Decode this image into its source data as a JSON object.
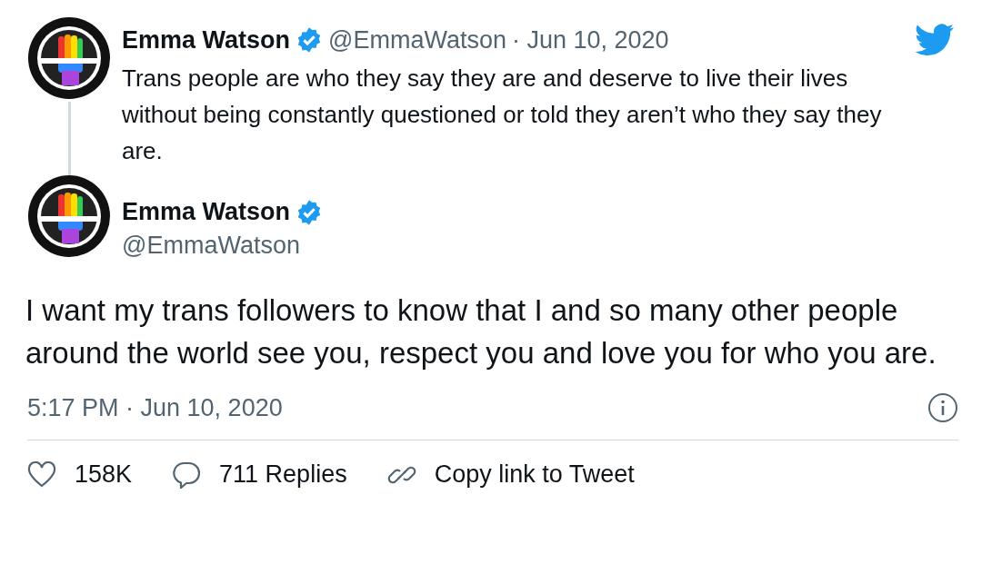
{
  "reply_to": {
    "author": "Emma Watson",
    "verified": true,
    "handle": "@EmmaWatson",
    "date": "· Jun 10, 2020",
    "text": "Trans people are who they say they are and deserve to live their lives without being constantly questioned or told they aren’t who they say they are."
  },
  "tweet": {
    "author": "Emma Watson",
    "verified": true,
    "handle": "@EmmaWatson",
    "text": "I want my trans followers to know that I and so many other people around the world see you, respect you and love you for who you are.",
    "timestamp": "5:17 PM · Jun 10, 2020"
  },
  "actions": [
    {
      "kind": "like",
      "label": "158K"
    },
    {
      "kind": "reply",
      "label": "711 Replies"
    },
    {
      "kind": "link",
      "label": "Copy link to Tweet"
    }
  ]
}
